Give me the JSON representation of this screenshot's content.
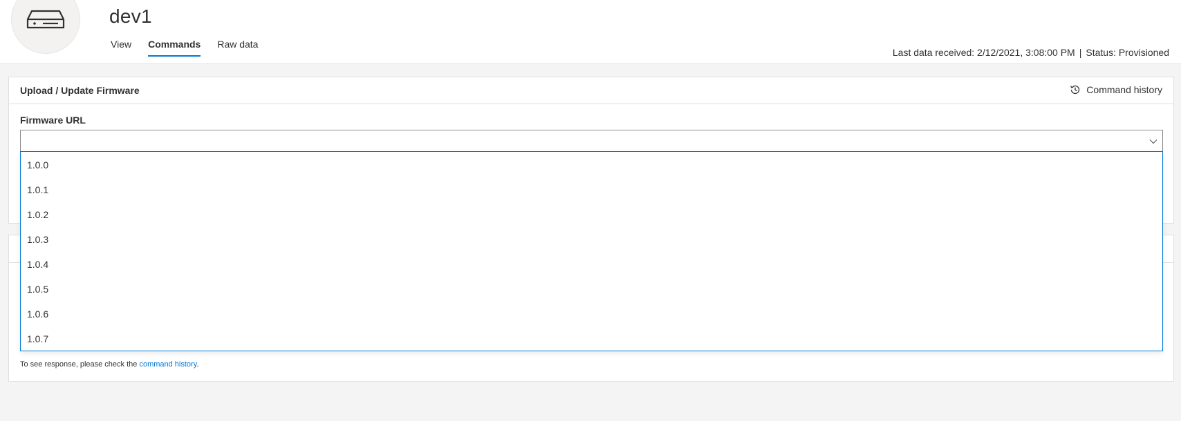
{
  "device": {
    "name": "dev1",
    "icon": "device-icon"
  },
  "tabs": [
    {
      "label": "View",
      "active": false
    },
    {
      "label": "Commands",
      "active": true
    },
    {
      "label": "Raw data",
      "active": false
    }
  ],
  "status": {
    "last_data": "Last data received: 2/12/2021, 3:08:00 PM",
    "separator": "|",
    "status_text": "Status: Provisioned"
  },
  "command": {
    "title": "Upload / Update Firmware",
    "history_label": "Command history",
    "history_icon": "history-icon",
    "field_label": "Firmware URL",
    "field_value": "",
    "chevron_icon": "chevron-down-icon"
  },
  "dropdown": {
    "options": [
      "1.0.0",
      "1.0.1",
      "1.0.2",
      "1.0.3",
      "1.0.4",
      "1.0.5",
      "1.0.6",
      "1.0.7"
    ]
  },
  "hint": {
    "prefix": "To see response, please check the ",
    "link": "command history",
    "suffix": "."
  },
  "colors": {
    "accent": "#0078d4",
    "background": "#f4f4f4",
    "border": "#e1dfdd"
  }
}
